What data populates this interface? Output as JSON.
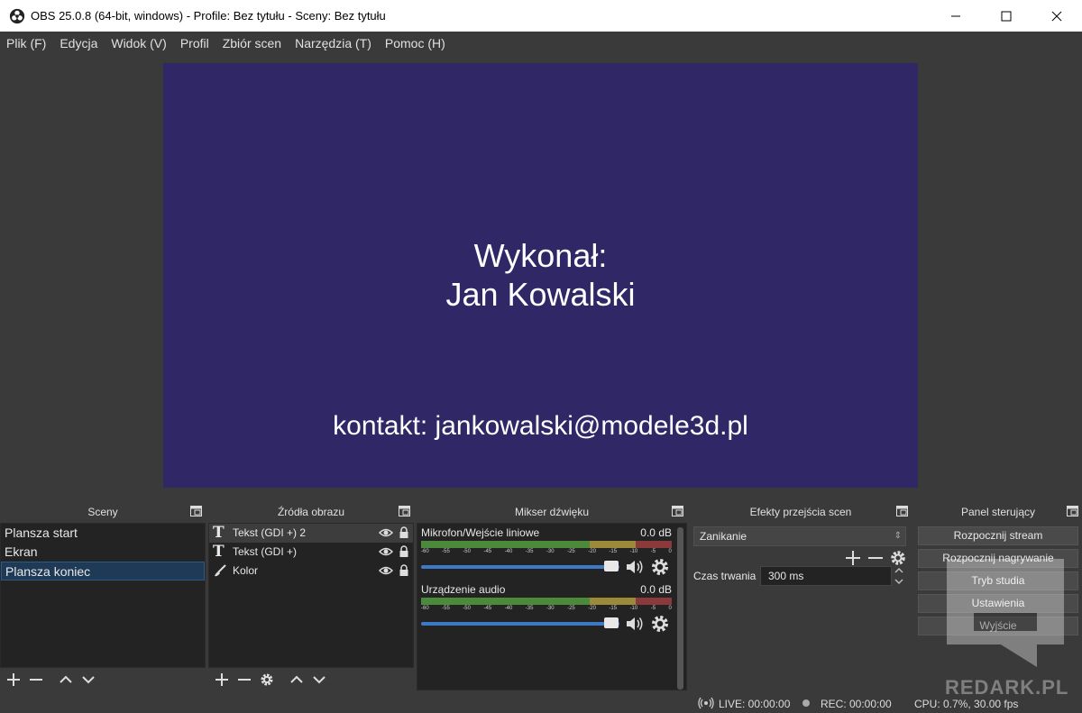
{
  "window": {
    "title": "OBS 25.0.8 (64-bit, windows) - Profile: Bez tytułu - Sceny: Bez tytułu"
  },
  "menu": [
    "Plik (F)",
    "Edycja",
    "Widok (V)",
    "Profil",
    "Zbiór scen",
    "Narzędzia (T)",
    "Pomoc (H)"
  ],
  "preview": {
    "line1": "Wykonał:",
    "line2": "Jan Kowalski",
    "line3": "kontakt: jankowalski@modele3d.pl",
    "background_color": "#2f2766"
  },
  "scenes": {
    "title": "Sceny",
    "items": [
      "Plansza start",
      "Ekran",
      "Plansza koniec"
    ],
    "selected_index": 2
  },
  "sources": {
    "title": "Źródła obrazu",
    "items": [
      {
        "label": "Tekst (GDI +) 2",
        "icon": "text-icon"
      },
      {
        "label": "Tekst (GDI +)",
        "icon": "text-icon"
      },
      {
        "label": "Kolor",
        "icon": "brush-icon"
      }
    ]
  },
  "mixer": {
    "title": "Mikser dźwięku",
    "channels": [
      {
        "name": "Mikrofon/Wejście liniowe",
        "db": "0.0 dB",
        "volume": 1.0
      },
      {
        "name": "Urządzenie audio",
        "db": "0.0 dB",
        "volume": 1.0
      }
    ],
    "ticks": [
      "-60",
      "-55",
      "-50",
      "-45",
      "-40",
      "-35",
      "-30",
      "-25",
      "-20",
      "-15",
      "-10",
      "-5",
      "0"
    ]
  },
  "transitions": {
    "title": "Efekty przejścia scen",
    "selected": "Zanikanie",
    "duration_label": "Czas trwania",
    "duration_value": "300 ms"
  },
  "controls": {
    "title": "Panel sterujący",
    "buttons": [
      "Rozpocznij stream",
      "Rozpocznij nagrywanie",
      "Tryb studia",
      "Ustawienia",
      "Wyjście"
    ]
  },
  "status": {
    "live": "LIVE: 00:00:00",
    "rec": "REC: 00:00:00",
    "cpu": "CPU: 0.7%, 30.00 fps"
  },
  "watermark": "REDARK.PL"
}
